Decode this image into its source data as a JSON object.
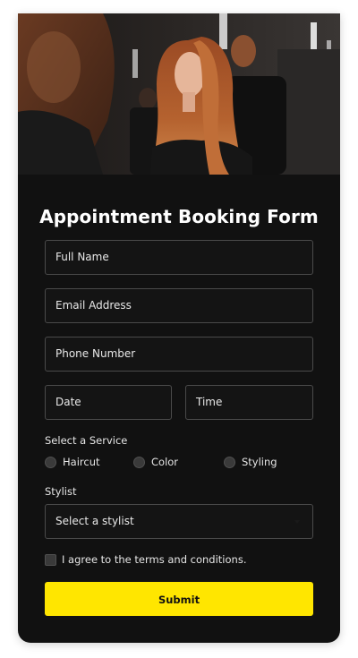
{
  "form": {
    "title": "Appointment Booking Form",
    "fields": {
      "full_name": "Full Name",
      "email": "Email Address",
      "phone": "Phone Number",
      "date": "Date",
      "time": "Time"
    },
    "service": {
      "label": "Select a Service",
      "options": [
        "Haircut",
        "Color",
        "Styling"
      ]
    },
    "stylist": {
      "label": "Stylist",
      "selected": "Select a stylist"
    },
    "terms_label": "I agree to the terms and conditions.",
    "submit_label": "Submit"
  },
  "colors": {
    "card_background": "#111111",
    "accent": "#ffe600"
  },
  "icons": {
    "select_arrow": "chevron-down-icon"
  }
}
